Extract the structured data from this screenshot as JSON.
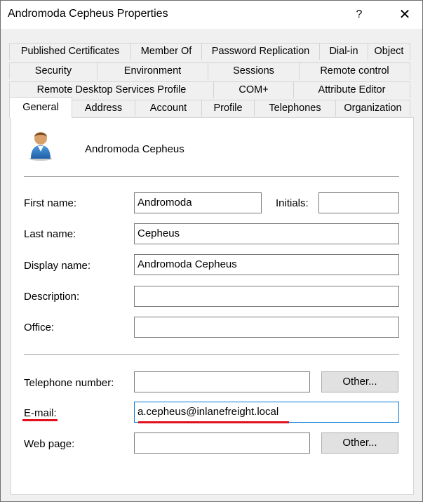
{
  "window": {
    "title": "Andromoda Cepheus Properties",
    "help_glyph": "?",
    "close_glyph": "✕"
  },
  "tabs": {
    "row1": [
      "Published Certificates",
      "Member Of",
      "Password Replication",
      "Dial-in",
      "Object"
    ],
    "row2": [
      "Security",
      "Environment",
      "Sessions",
      "Remote control"
    ],
    "row3": [
      "Remote Desktop Services Profile",
      "COM+",
      "Attribute Editor"
    ],
    "row4": [
      "General",
      "Address",
      "Account",
      "Profile",
      "Telephones",
      "Organization"
    ],
    "active": "General"
  },
  "general": {
    "header_name": "Andromoda Cepheus",
    "first_name_label": "First name:",
    "first_name_value": "Andromoda",
    "initials_label": "Initials:",
    "initials_value": "",
    "last_name_label": "Last name:",
    "last_name_value": "Cepheus",
    "display_name_label": "Display name:",
    "display_name_value": "Andromoda Cepheus",
    "description_label": "Description:",
    "description_value": "",
    "office_label": "Office:",
    "office_value": "",
    "telephone_label": "Telephone number:",
    "telephone_value": "",
    "telephone_other_label": "Other...",
    "email_label": "E-mail:",
    "email_value": "a.cepheus@inlanefreight.local",
    "webpage_label": "Web page:",
    "webpage_value": "",
    "webpage_other_label": "Other..."
  },
  "annotations": {
    "highlight_color": "#e0101e"
  }
}
